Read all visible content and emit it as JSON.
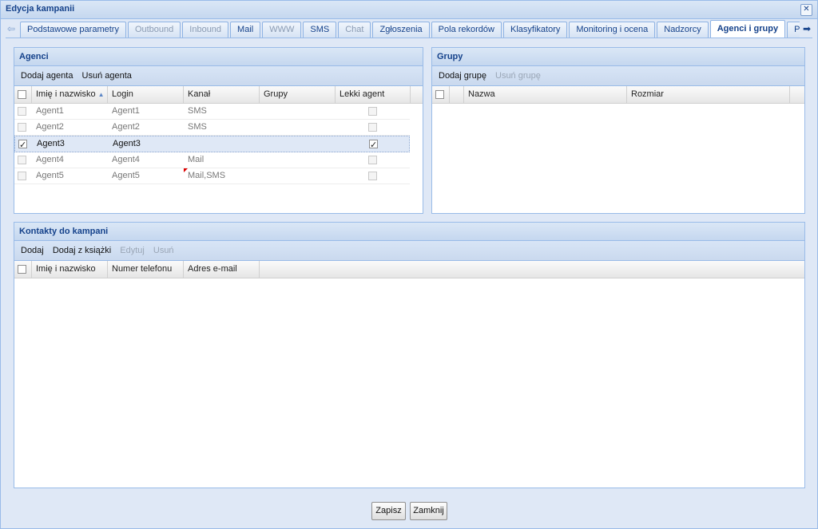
{
  "window": {
    "title": "Edycja kampanii",
    "close_icon": "close-icon"
  },
  "tabs": [
    {
      "label": "Podstawowe parametry",
      "state": "normal"
    },
    {
      "label": "Outbound",
      "state": "disabled"
    },
    {
      "label": "Inbound",
      "state": "disabled"
    },
    {
      "label": "Mail",
      "state": "normal"
    },
    {
      "label": "WWW",
      "state": "disabled"
    },
    {
      "label": "SMS",
      "state": "normal"
    },
    {
      "label": "Chat",
      "state": "disabled"
    },
    {
      "label": "Zgłoszenia",
      "state": "normal"
    },
    {
      "label": "Pola rekordów",
      "state": "normal"
    },
    {
      "label": "Klasyfikatory",
      "state": "normal"
    },
    {
      "label": "Monitoring i ocena",
      "state": "normal"
    },
    {
      "label": "Nadzorcy",
      "state": "normal"
    },
    {
      "label": "Agenci i grupy",
      "state": "active"
    },
    {
      "label": "Priorytet",
      "state": "normal"
    }
  ],
  "agenci": {
    "title": "Agenci",
    "toolbar": {
      "add": "Dodaj agenta",
      "remove": "Usuń agenta"
    },
    "columns": [
      "Imię i nazwisko",
      "Login",
      "Kanał",
      "Grupy",
      "Lekki agent"
    ],
    "rows": [
      {
        "name": "Agent1",
        "login": "Agent1",
        "kanal": "SMS",
        "grupy": "",
        "selected": false,
        "lekki": false
      },
      {
        "name": "Agent2",
        "login": "Agent2",
        "kanal": "SMS",
        "grupy": "",
        "selected": false,
        "lekki": false
      },
      {
        "name": "Agent3",
        "login": "Agent3",
        "kanal": "",
        "grupy": "",
        "selected": true,
        "lekki": true
      },
      {
        "name": "Agent4",
        "login": "Agent4",
        "kanal": "Mail",
        "grupy": "",
        "selected": false,
        "lekki": false
      },
      {
        "name": "Agent5",
        "login": "Agent5",
        "kanal": "Mail,SMS",
        "grupy": "",
        "selected": false,
        "lekki": false
      }
    ]
  },
  "grupy": {
    "title": "Grupy",
    "toolbar": {
      "add": "Dodaj grupę",
      "remove": "Usuń grupę"
    },
    "columns": [
      "Nazwa",
      "Rozmiar"
    ]
  },
  "kontakty": {
    "title": "Kontakty do kampani",
    "toolbar": {
      "add": "Dodaj",
      "add_from_book": "Dodaj z książki",
      "edit": "Edytuj",
      "remove": "Usuń"
    },
    "columns": [
      "Imię i nazwisko",
      "Numer telefonu",
      "Adres e-mail"
    ]
  },
  "footer": {
    "save": "Zapisz",
    "close": "Zamknij"
  },
  "colors": {
    "accent": "#15428b",
    "border": "#99bbe8",
    "background": "#dfe8f6"
  }
}
